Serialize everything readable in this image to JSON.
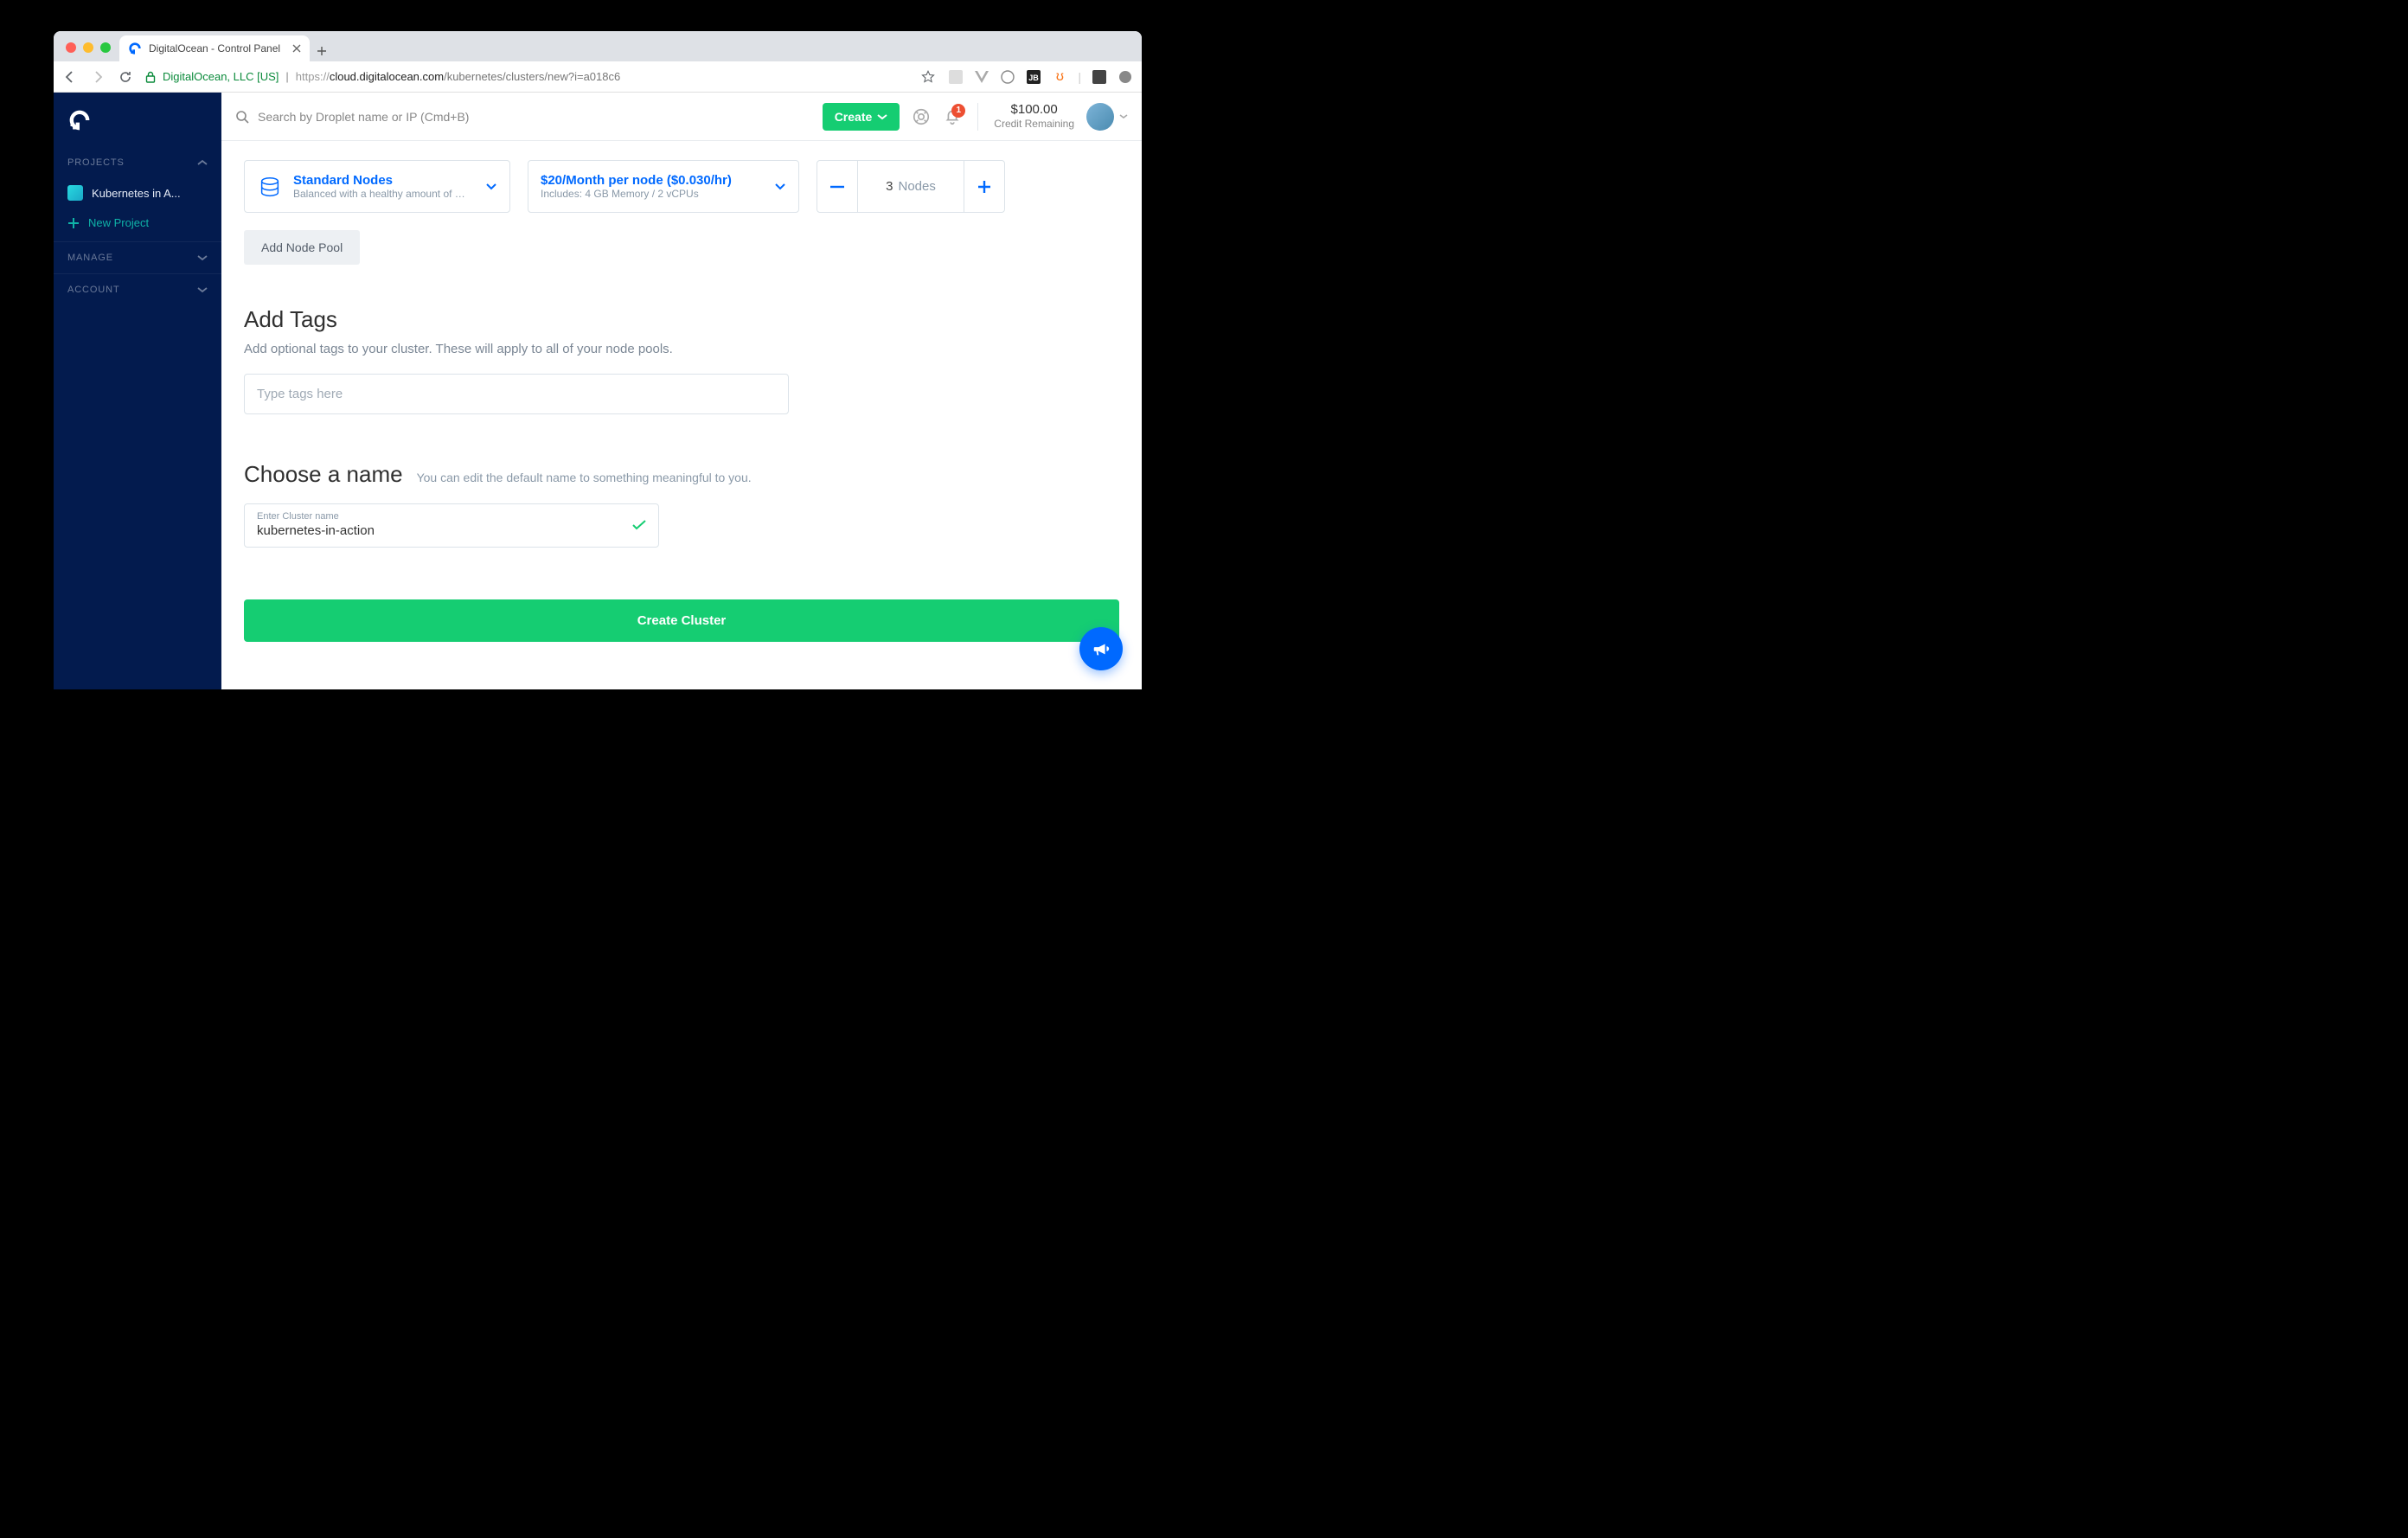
{
  "browser": {
    "tab_title": "DigitalOcean - Control Panel",
    "url_org": "DigitalOcean, LLC [US]",
    "url_proto": "https://",
    "url_domain": "cloud.digitalocean.com",
    "url_path": "/kubernetes/clusters/new?i=a018c6"
  },
  "sidebar": {
    "projects_label": "PROJECTS",
    "project_name": "Kubernetes in A...",
    "new_project_label": "New Project",
    "manage_label": "MANAGE",
    "account_label": "ACCOUNT"
  },
  "topbar": {
    "search_placeholder": "Search by Droplet name or IP (Cmd+B)",
    "create_label": "Create",
    "notification_count": "1",
    "credit_amount": "$100.00",
    "credit_label": "Credit Remaining"
  },
  "node_pool": {
    "type_title": "Standard Nodes",
    "type_sub": "Balanced with a healthy amount of memo...",
    "plan_title": "$20/Month per node ($0.030/hr)",
    "plan_sub": "Includes: 4 GB Memory / 2 vCPUs",
    "count_value": "3",
    "count_label": "Nodes",
    "add_pool_label": "Add Node Pool"
  },
  "tags": {
    "title": "Add Tags",
    "desc": "Add optional tags to your cluster. These will apply to all of your node pools.",
    "placeholder": "Type tags here"
  },
  "name": {
    "title": "Choose a name",
    "sub": "You can edit the default name to something meaningful to you.",
    "field_label": "Enter Cluster name",
    "field_value": "kubernetes-in-action"
  },
  "submit_label": "Create Cluster"
}
